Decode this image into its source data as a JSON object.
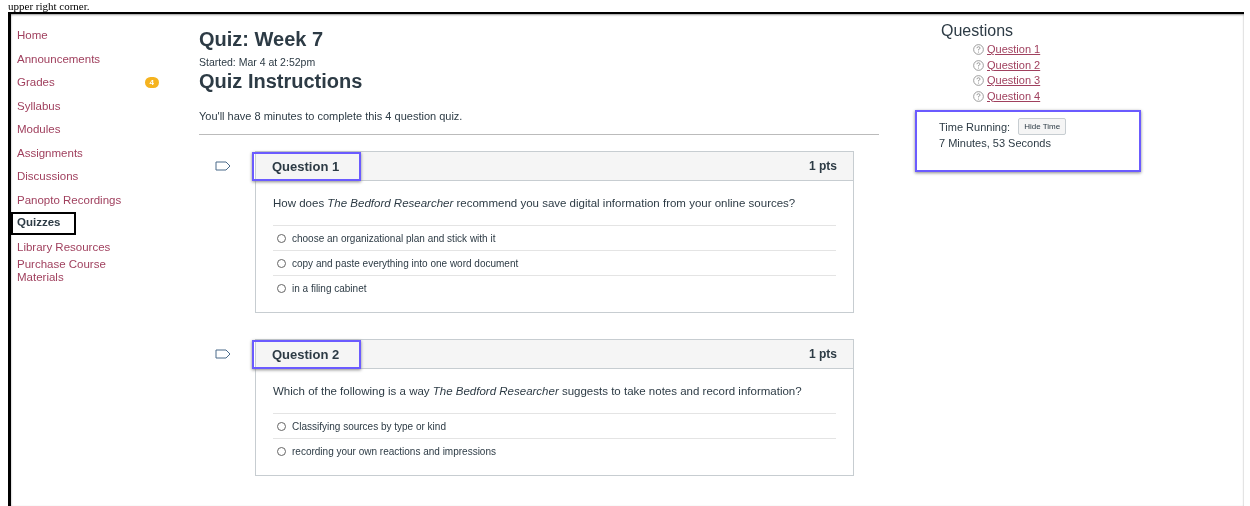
{
  "caption": "upper right corner.",
  "sidebar": {
    "items": [
      {
        "label": "Home",
        "selected": false
      },
      {
        "label": "Announcements",
        "selected": false
      },
      {
        "label": "Grades",
        "selected": false,
        "badge": "4"
      },
      {
        "label": "Syllabus",
        "selected": false
      },
      {
        "label": "Modules",
        "selected": false
      },
      {
        "label": "Assignments",
        "selected": false
      },
      {
        "label": "Discussions",
        "selected": false
      },
      {
        "label": "Panopto Recordings",
        "selected": false
      },
      {
        "label": "Quizzes",
        "selected": true
      },
      {
        "label": "Library Resources",
        "selected": false
      },
      {
        "label": "Purchase Course Materials",
        "selected": false
      }
    ]
  },
  "quiz": {
    "title": "Quiz: Week 7",
    "started": "Started: Mar 4 at 2:52pm",
    "instructions_heading": "Quiz Instructions",
    "instructions": "You'll have 8 minutes to complete this 4 question quiz.",
    "questions": [
      {
        "title": "Question 1",
        "points": "1 pts",
        "highlighted": true,
        "text": "How does *The Bedford Researcher* recommend you save digital information from your online sources?",
        "answers": [
          {
            "label": "choose an organizational plan and stick with it",
            "selected": false
          },
          {
            "label": "copy and paste everything into one word document",
            "selected": false
          },
          {
            "label": "in a filing cabinet",
            "selected": false
          }
        ]
      },
      {
        "title": "Question 2",
        "points": "1 pts",
        "highlighted": true,
        "text": "Which of the following is a way *The Bedford Researcher* suggests to take notes and record information?",
        "answers": [
          {
            "label": "Classifying sources by type or kind",
            "selected": false
          },
          {
            "label": "recording your own reactions and impressions",
            "selected": false
          }
        ]
      }
    ]
  },
  "questions_panel": {
    "heading": "Questions",
    "items": [
      "Question 1",
      "Question 2",
      "Question 3",
      "Question 4"
    ]
  },
  "timer": {
    "label": "Time Running:",
    "button": "Hide Time",
    "value": "7 Minutes, 53 Seconds",
    "highlighted": true
  }
}
